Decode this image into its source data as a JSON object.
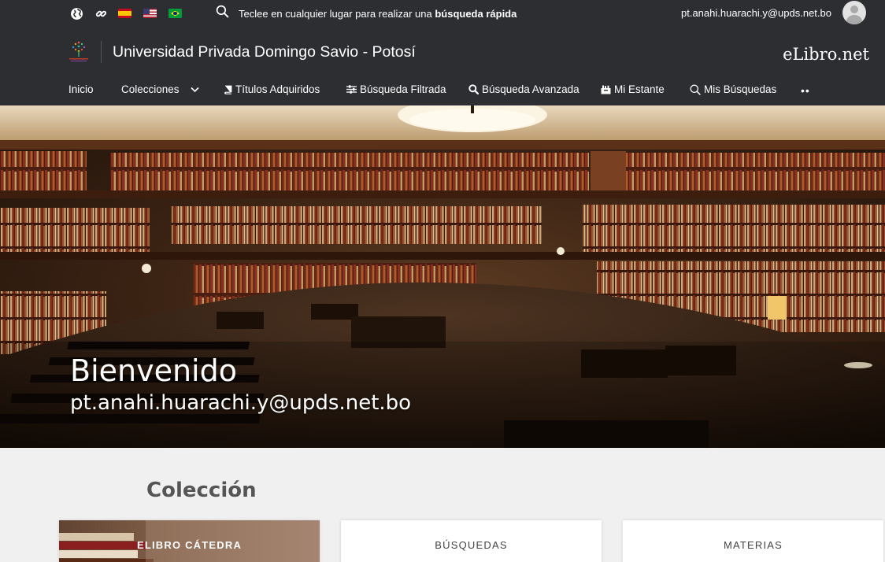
{
  "topbar": {
    "quick_search_text": "Teclee en cualquier lugar para realizar una ",
    "quick_search_bold": "búsqueda rápida",
    "user_email": "pt.anahi.huarachi.y@upds.net.bo"
  },
  "header": {
    "university_name": "Universidad Privada Domingo Savio - Potosí",
    "logo_text": "eLibro.net"
  },
  "nav": {
    "items": [
      {
        "label": "Inicio",
        "icon": ""
      },
      {
        "label": "Colecciones",
        "icon": "chevron-down-icon"
      },
      {
        "label": "Títulos Adquiridos",
        "icon": "book-icon"
      },
      {
        "label": "Búsqueda Filtrada",
        "icon": "sliders-icon"
      },
      {
        "label": "Búsqueda Avanzada",
        "icon": "search-icon"
      },
      {
        "label": "Mi Estante",
        "icon": "shelf-icon"
      },
      {
        "label": "Mis Búsquedas",
        "icon": "search-icon"
      }
    ],
    "more": "••"
  },
  "hero": {
    "welcome": "Bienvenido",
    "email": "pt.anahi.huarachi.y@upds.net.bo"
  },
  "collection": {
    "title": "Colección",
    "cards": [
      {
        "label": "ELIBRO CÁTEDRA"
      },
      {
        "label": "BÚSQUEDAS"
      },
      {
        "label": "MATERIAS"
      }
    ]
  },
  "colors": {
    "topbar_bg": "#2d2e31",
    "page_bg": "#f0f0f0"
  }
}
